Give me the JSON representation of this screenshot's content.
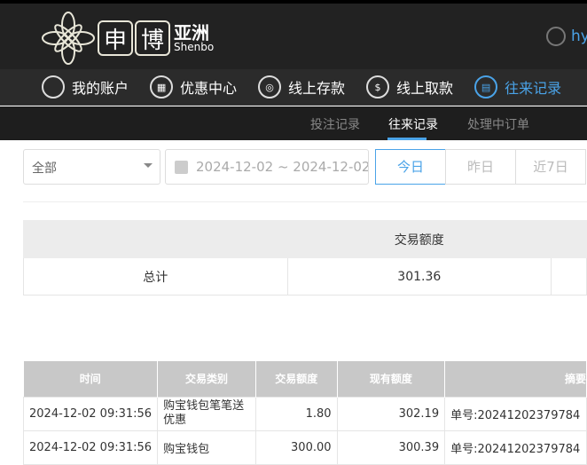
{
  "header": {
    "brand_chars": [
      "申",
      "博"
    ],
    "brand_asia": "亚洲",
    "brand_en": "Shenbo",
    "username": "hy"
  },
  "nav": [
    {
      "label": "我的账户",
      "icon": "user-icon"
    },
    {
      "label": "优惠中心",
      "icon": "gift-icon"
    },
    {
      "label": "线上存款",
      "icon": "deposit-icon"
    },
    {
      "label": "线上取款",
      "icon": "withdraw-icon"
    },
    {
      "label": "往来记录",
      "icon": "record-icon",
      "active": true
    }
  ],
  "subnav": [
    {
      "label": "投注记录"
    },
    {
      "label": "往来记录",
      "active": true
    },
    {
      "label": "处理中订单"
    }
  ],
  "filters": {
    "type": "全部",
    "date_range": "2024-12-02 ~ 2024-12-02",
    "buttons": [
      "今日",
      "昨日",
      "近7日"
    ],
    "active": "今日"
  },
  "summary": {
    "header": "交易额度",
    "label": "总计",
    "value": "301.36"
  },
  "table": {
    "columns": [
      "时间",
      "交易类别",
      "交易额度",
      "现有额度",
      "摘要"
    ],
    "rows": [
      [
        "2024-12-02 09:31:56",
        "购宝钱包笔笔送优惠",
        "1.80",
        "302.19",
        "单号:20241202379784"
      ],
      [
        "2024-12-02 09:31:56",
        "购宝钱包",
        "300.00",
        "300.39",
        "单号:20241202379784"
      ]
    ]
  },
  "colors": {
    "accent": "#4aa3e8"
  }
}
